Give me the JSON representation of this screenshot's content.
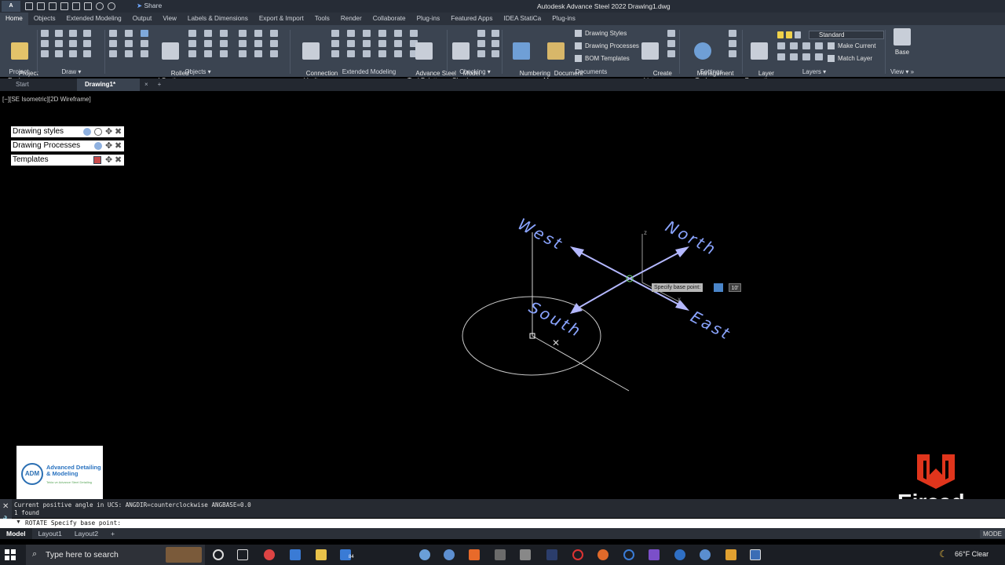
{
  "titlebar": {
    "app_logo": "A",
    "share": "Share",
    "title": "Autodesk Advance Steel 2022    Drawing1.dwg"
  },
  "ribbon_tabs": [
    "Home",
    "Objects",
    "Extended Modeling",
    "Output",
    "View",
    "Labels & Dimensions",
    "Export & Import",
    "Tools",
    "Render",
    "Collaborate",
    "Plug-ins",
    "Featured Apps",
    "IDEA StatiCa",
    "Plug-ins"
  ],
  "panels": {
    "project": {
      "label": "Project",
      "button": "Project\nExplorer"
    },
    "draw": {
      "label": "Draw"
    },
    "objects": {
      "label": "Objects",
      "button": "Rolled\nI Section"
    },
    "extended": {
      "label": "Extended Modeling",
      "connection": "Connection\nVault",
      "tool_palette": "Advance Steel\nTool Palette"
    },
    "checking": {
      "label": "Checking",
      "model_check": "Model\nCheck"
    },
    "documents": {
      "label": "Documents",
      "numbering": "Numbering",
      "doc_manager": "Document\nManager",
      "drawing_styles": "Drawing Styles",
      "drawing_processes": "Drawing Processes",
      "bom_templates": "BOM Templates",
      "create_lists": "Create\nLists"
    },
    "settings": {
      "label": "Settings",
      "management": "Management\nTools"
    },
    "layers": {
      "label": "Layers",
      "layer_props": "Layer\nProperties",
      "current_layer": "Standard",
      "make_current": "Make Current",
      "match_layer": "Match Layer"
    },
    "view": {
      "label": "View",
      "base": "Base"
    }
  },
  "file_tabs": {
    "start": "Start",
    "drawing": "Drawing1*",
    "close": "×",
    "new": "+"
  },
  "viewport_label": "[−][SE Isometric][2D Wireframe]",
  "palettes": [
    {
      "label": "Drawing styles"
    },
    {
      "label": "Drawing Processes"
    },
    {
      "label": "Templates"
    }
  ],
  "drawing": {
    "texts": {
      "west": "West",
      "north": "North",
      "south": "South",
      "east": "East",
      "z": "z",
      "x": "x"
    },
    "tooltip": "Specify base point:",
    "tooltip_value": "10'"
  },
  "logos": {
    "adm_mark": "ADM",
    "adm_name": "Advanced Detailing\n& Modeling",
    "adm_tagline": "Tekla ve Advance Steel Detailing",
    "eircad": "Eircad"
  },
  "command": {
    "history_1": "Current positive angle in UCS:  ANGDIR=counterclockwise  ANGBASE=0.0",
    "history_2": "1 found",
    "prompt": "ROTATE Specify base point:"
  },
  "layout_tabs": [
    "Model",
    "Layout1",
    "Layout2",
    "+"
  ],
  "status": {
    "model": "MODE"
  },
  "taskbar": {
    "search_placeholder": "Type here to search",
    "weather": "66°F  Clear",
    "mail_count": "84"
  },
  "colors": {
    "ribbon_bg": "#3b4451",
    "text_blue": "#7e9fff",
    "canvas_bg": "#000000",
    "eircad_red": "#e0351c"
  }
}
